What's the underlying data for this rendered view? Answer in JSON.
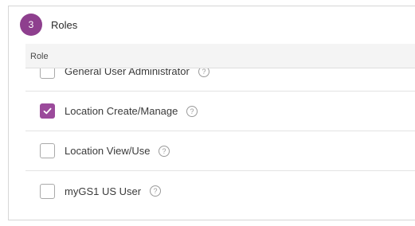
{
  "section": {
    "step_number": "3",
    "title": "Roles"
  },
  "table": {
    "column_header": "Role"
  },
  "roles": [
    {
      "label": "General User Administrator",
      "checked": false,
      "help_icon": "question-circle-icon"
    },
    {
      "label": "Location Create/Manage",
      "checked": true,
      "help_icon": "question-circle-icon"
    },
    {
      "label": "Location View/Use",
      "checked": false,
      "help_icon": "question-circle-icon"
    },
    {
      "label": "myGS1 US User",
      "checked": false,
      "help_icon": "question-circle-icon"
    }
  ],
  "colors": {
    "accent": "#9b4a9b",
    "badge": "#8e3f8e"
  }
}
